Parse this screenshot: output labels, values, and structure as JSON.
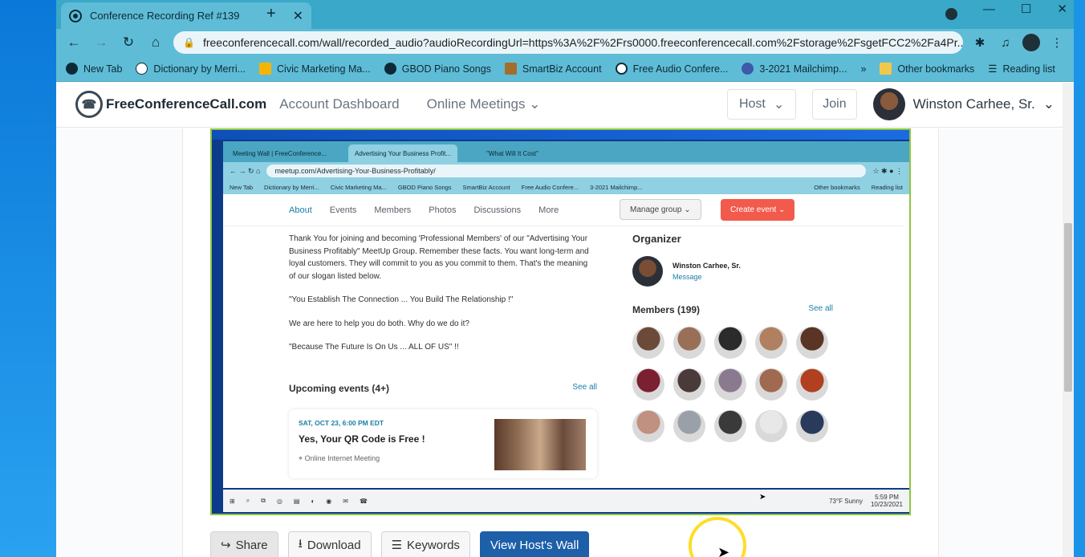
{
  "browser": {
    "tab": {
      "title": "Conference Recording Ref #139",
      "close": "✕"
    },
    "new_tab": "+",
    "window_controls": [
      "—",
      "☐",
      "✕"
    ],
    "address": "freeconferencecall.com/wall/recorded_audio?audioRecordingUrl=https%3A%2F%2Frs0000.freeconferencecall.com%2Fstorage%2FsgetFCC2%2Fa4Pr...",
    "bookmarks": [
      "New Tab",
      "Dictionary by Merri...",
      "Civic Marketing Ma...",
      "GBOD Piano Songs",
      "SmartBiz Account",
      "Free Audio Confere...",
      "3-2021 Mailchimp..."
    ],
    "bookmarks_more": "»",
    "other_bookmarks": "Other bookmarks",
    "reading_list": "Reading list"
  },
  "site": {
    "logo": "FreeConferenceCall.com",
    "nav": [
      "Account Dashboard",
      "Online Meetings"
    ],
    "host": "Host",
    "join": "Join",
    "user": "Winston Carhee, Sr."
  },
  "video": {
    "inner_tabs": [
      "Meeting Wall | FreeConference...",
      "Advertising Your Business Profit...",
      "\"What Will It Cost\""
    ],
    "inner_address": "meetup.com/Advertising-Your-Business-Profitably/",
    "inner_bookmarks": [
      "New Tab",
      "Dictionary by Merri...",
      "Civic Marketing Ma...",
      "GBOD Piano Songs",
      "SmartBiz Account",
      "Free Audio Confere...",
      "3-2021 Mailchimp..."
    ],
    "inner_other": "Other bookmarks",
    "inner_reading": "Reading list",
    "meetup_nav": [
      "About",
      "Events",
      "Members",
      "Photos",
      "Discussions",
      "More"
    ],
    "manage_group": "Manage group",
    "create_event": "Create event",
    "about_paragraphs": [
      "Thank You for joining and becoming 'Professional Members' of our \"Advertising Your Business Profitably\" MeetUp Group. Remember these facts. You want long-term and loyal customers. They will commit to you as you commit to them. That's the meaning of our slogan listed below.",
      "\"You Establish The Connection ... You Build The Relationship !\"",
      "We are here to help you do both. Why do we do it?",
      "\"Because The Future Is On Us ... ALL OF US\" !!"
    ],
    "upcoming": "Upcoming events (4+)",
    "see_all": "See all",
    "event": {
      "date": "SAT, OCT 23, 6:00 PM EDT",
      "title": "Yes, Your QR Code is Free !",
      "location": "Online Internet Meeting"
    },
    "organizer_title": "Organizer",
    "organizer_name": "Winston Carhee, Sr.",
    "organizer_msg": "Message",
    "members": "Members (199)",
    "members_see_all": "See all",
    "member_colors": [
      "#6b4a3a",
      "#9a6f58",
      "#2b2b2b",
      "#b08060",
      "#5a3525",
      "#7a2030",
      "#4a3a3a",
      "#8a7a90",
      "#a06a50",
      "#b04020",
      "#c09080",
      "#9aa0a8",
      "#3a3a3a",
      "#e8e8e8",
      "#2a3a5a"
    ],
    "taskbar_weather": "73°F  Sunny",
    "taskbar_time": "5:59 PM",
    "taskbar_date": "10/23/2021"
  },
  "actions": {
    "share": "Share",
    "download": "Download",
    "keywords": "Keywords",
    "view_host_wall": "View Host's Wall"
  }
}
